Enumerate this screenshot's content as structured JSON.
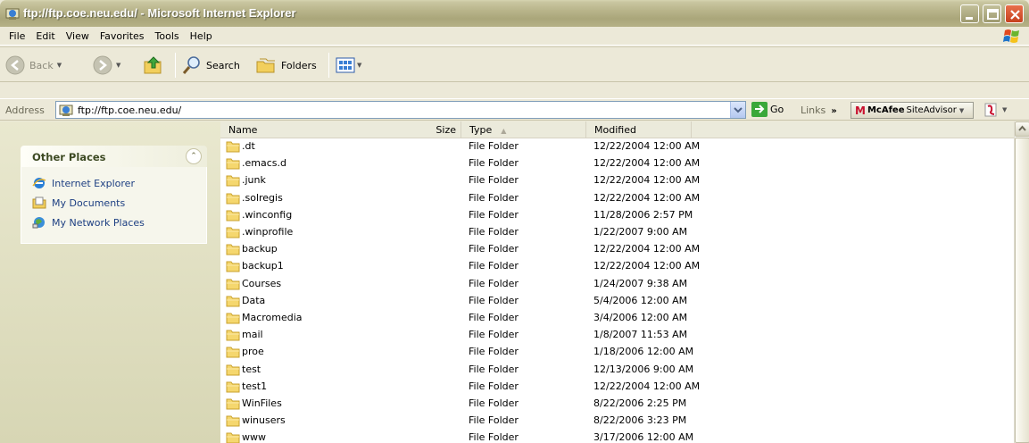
{
  "window": {
    "title": "ftp://ftp.coe.neu.edu/ - Microsoft Internet Explorer"
  },
  "menu": [
    "File",
    "Edit",
    "View",
    "Favorites",
    "Tools",
    "Help"
  ],
  "toolbar": {
    "back_label": "Back",
    "search_label": "Search",
    "folders_label": "Folders"
  },
  "address": {
    "label": "Address",
    "value": "ftp://ftp.coe.neu.edu/",
    "go_label": "Go",
    "links_label": "Links",
    "mcafee_m": "M",
    "mcafee_brand": "McAfee",
    "mcafee_product": "SiteAdvisor"
  },
  "sidebar": {
    "title": "Other Places",
    "items": [
      {
        "label": "Internet Explorer",
        "icon": "internet-explorer-icon"
      },
      {
        "label": "My Documents",
        "icon": "my-documents-icon"
      },
      {
        "label": "My Network Places",
        "icon": "network-places-icon"
      }
    ]
  },
  "columns": {
    "name": "Name",
    "size": "Size",
    "type": "Type",
    "modified": "Modified"
  },
  "files": [
    {
      "name": ".dt",
      "type": "File Folder",
      "modified": "12/22/2004 12:00 AM"
    },
    {
      "name": ".emacs.d",
      "type": "File Folder",
      "modified": "12/22/2004 12:00 AM"
    },
    {
      "name": ".junk",
      "type": "File Folder",
      "modified": "12/22/2004 12:00 AM"
    },
    {
      "name": ".solregis",
      "type": "File Folder",
      "modified": "12/22/2004 12:00 AM"
    },
    {
      "name": ".winconfig",
      "type": "File Folder",
      "modified": "11/28/2006 2:57 PM"
    },
    {
      "name": ".winprofile",
      "type": "File Folder",
      "modified": "1/22/2007 9:00 AM"
    },
    {
      "name": "backup",
      "type": "File Folder",
      "modified": "12/22/2004 12:00 AM"
    },
    {
      "name": "backup1",
      "type": "File Folder",
      "modified": "12/22/2004 12:00 AM"
    },
    {
      "name": "Courses",
      "type": "File Folder",
      "modified": "1/24/2007 9:38 AM"
    },
    {
      "name": "Data",
      "type": "File Folder",
      "modified": "5/4/2006 12:00 AM"
    },
    {
      "name": "Macromedia",
      "type": "File Folder",
      "modified": "3/4/2006 12:00 AM"
    },
    {
      "name": "mail",
      "type": "File Folder",
      "modified": "1/8/2007 11:53 AM"
    },
    {
      "name": "proe",
      "type": "File Folder",
      "modified": "1/18/2006 12:00 AM"
    },
    {
      "name": "test",
      "type": "File Folder",
      "modified": "12/13/2006 9:00 AM"
    },
    {
      "name": "test1",
      "type": "File Folder",
      "modified": "12/22/2004 12:00 AM"
    },
    {
      "name": "WinFiles",
      "type": "File Folder",
      "modified": "8/22/2006 2:25 PM"
    },
    {
      "name": "winusers",
      "type": "File Folder",
      "modified": "8/22/2006 3:23 PM"
    },
    {
      "name": "www",
      "type": "File Folder",
      "modified": "3/17/2006 12:00 AM"
    }
  ],
  "colors": {
    "titlebar": "#b5b186",
    "chrome": "#ECE9D8",
    "link": "#1d3f82",
    "panel_title": "#3d4a23"
  }
}
